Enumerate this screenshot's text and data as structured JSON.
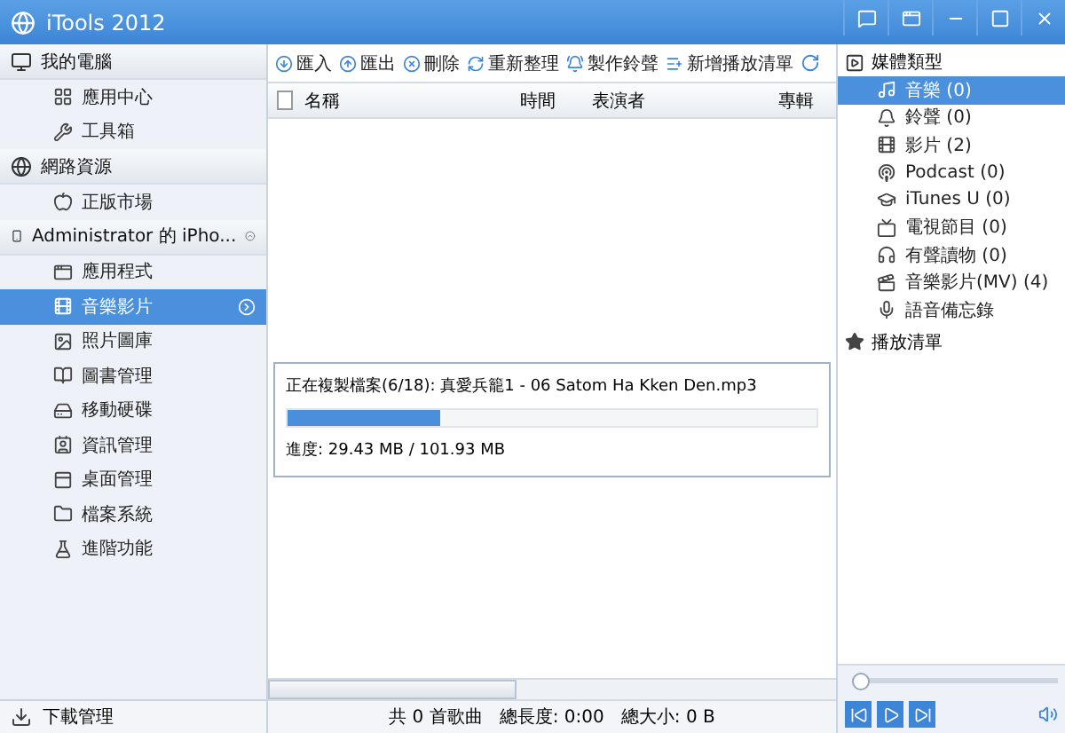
{
  "window": {
    "title": "iTools 2012"
  },
  "sidebar": {
    "groups": [
      {
        "label": "我的電腦",
        "eject": false,
        "items": [
          {
            "label": "應用中心",
            "selected": false
          },
          {
            "label": "工具箱",
            "selected": false
          }
        ]
      },
      {
        "label": "網路資源",
        "eject": false,
        "items": [
          {
            "label": "正版市場",
            "selected": false
          }
        ]
      },
      {
        "label": "Administrator 的 iPho...",
        "eject": true,
        "items": [
          {
            "label": "應用程式",
            "selected": false
          },
          {
            "label": "音樂影片",
            "selected": true
          },
          {
            "label": "照片圖庫",
            "selected": false
          },
          {
            "label": "圖書管理",
            "selected": false
          },
          {
            "label": "移動硬碟",
            "selected": false
          },
          {
            "label": "資訊管理",
            "selected": false
          },
          {
            "label": "桌面管理",
            "selected": false
          },
          {
            "label": "檔案系統",
            "selected": false
          },
          {
            "label": "進階功能",
            "selected": false
          }
        ]
      }
    ],
    "footer": "下載管理"
  },
  "toolbar": [
    "匯入",
    "匯出",
    "刪除",
    "重新整理",
    "製作鈴聲",
    "新增播放清單"
  ],
  "table": {
    "columns": [
      "名稱",
      "時間",
      "表演者",
      "專輯"
    ],
    "select_all": false
  },
  "dialog": {
    "message": "正在複製檔案(6/18): 真愛兵籠1 - 06 Satom Ha Kken Den.mp3",
    "level": 0.29,
    "progress": "進度: 29.43 MB / 101.93 MB"
  },
  "status_bar": "共 0 首歌曲   總長度: 0:00   總大小: 0 B",
  "media_panel": {
    "title": "媒體類型",
    "items": [
      {
        "label": "音樂 (0)",
        "selected": true
      },
      {
        "label": "鈴聲 (0)",
        "selected": false
      },
      {
        "label": "影片 (2)",
        "selected": false
      },
      {
        "label": "Podcast (0)",
        "selected": false
      },
      {
        "label": "iTunes U (0)",
        "selected": false
      },
      {
        "label": "電視節目 (0)",
        "selected": false
      },
      {
        "label": "有聲讀物 (0)",
        "selected": false
      },
      {
        "label": "音樂影片(MV) (4)",
        "selected": false
      },
      {
        "label": "語音備忘錄",
        "selected": false
      }
    ],
    "playlists": "播放清單"
  },
  "player": {
    "level": 0
  }
}
